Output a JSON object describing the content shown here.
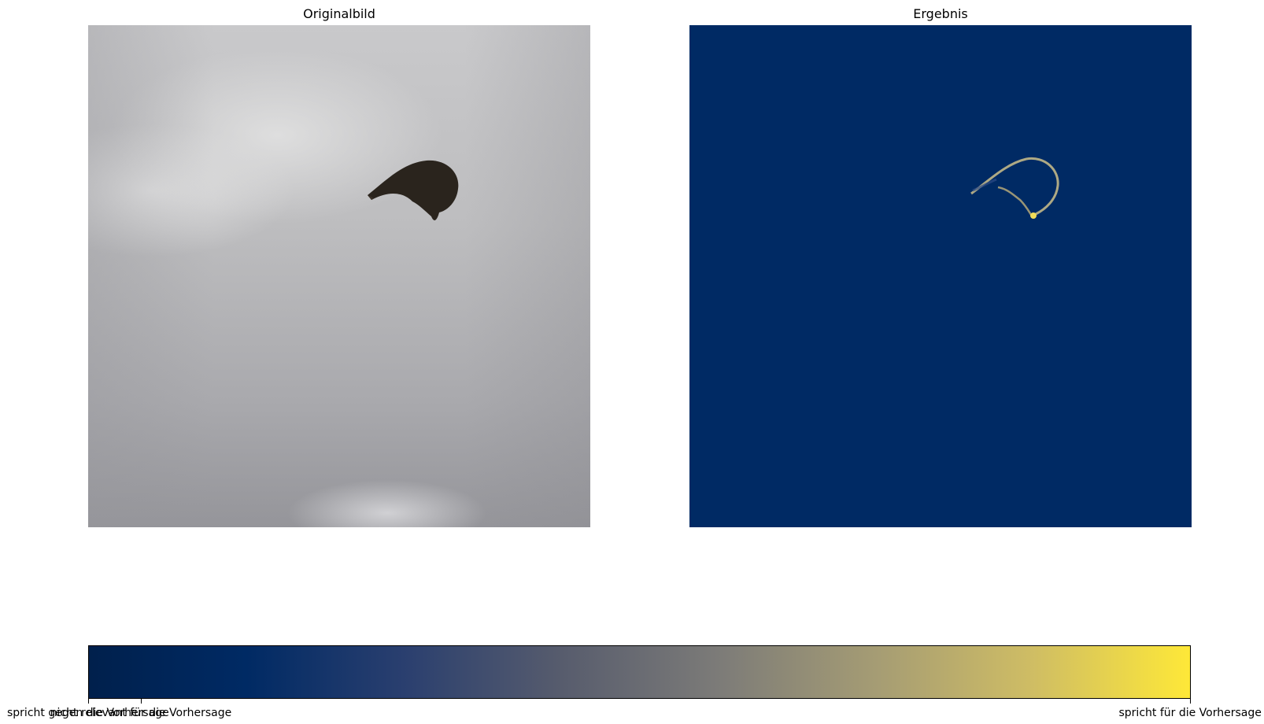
{
  "panels": {
    "left_title": "Originalbild",
    "right_title": "Ergebnis"
  },
  "colorbar": {
    "colormap": "cividis",
    "colors": [
      "#00204c",
      "#002a64",
      "#2a3f6f",
      "#575c6d",
      "#7c7b78",
      "#a59c74",
      "#cfbd64",
      "#fee838"
    ],
    "ticks": [
      {
        "value": 0.0,
        "label": "spricht gegen die Vorhersage"
      },
      {
        "value": 0.048,
        "label": "nicht relevant für die Vorhersage"
      },
      {
        "value": 1.0,
        "label": "spricht für die Vorhersage"
      }
    ]
  }
}
